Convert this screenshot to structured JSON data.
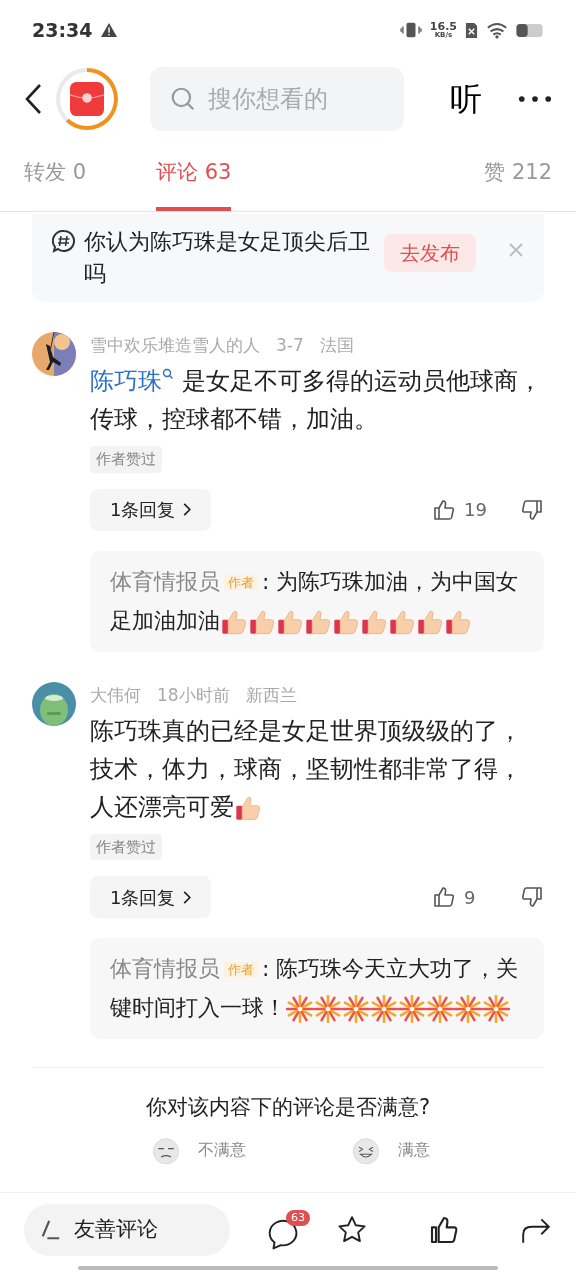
{
  "status_bar": {
    "time": "23:34",
    "net_speed": "16.5",
    "net_unit": "KB/s"
  },
  "header": {
    "search": {
      "placeholder": "搜你想看的"
    },
    "listen": "听"
  },
  "tabs": [
    {
      "label": "转发 0",
      "selected": false
    },
    {
      "label": "评论 63",
      "selected": true
    },
    {
      "label": "赞 212",
      "selected": false
    }
  ],
  "topic": {
    "text": "你认为陈巧珠是女足顶尖后卫吗",
    "button": "去发布"
  },
  "comments": [
    {
      "user": "雪中欢乐堆造雪人的人",
      "time": "3-7",
      "location": "法国",
      "mention": "陈巧珠",
      "text": "是女足不可多得的运动员他球商，传球，控球都不错，加油。",
      "badge": "作者赞过",
      "replies_button": "1条回复",
      "likes": "19",
      "reply": {
        "author": "体育情报员",
        "tag": "作者",
        "text": ": 为陈巧珠加油，为中国女足加油加油",
        "emojis": [
          {
            "kind": "thumbs"
          },
          {
            "kind": "thumbs"
          },
          {
            "kind": "thumbs"
          },
          {
            "kind": "thumbs"
          },
          {
            "kind": "thumbs"
          },
          {
            "kind": "thumbs"
          },
          {
            "kind": "thumbs"
          },
          {
            "kind": "thumbs"
          },
          {
            "kind": "thumbs"
          }
        ]
      }
    },
    {
      "user": "大伟何",
      "time": "18小时前",
      "location": "新西兰",
      "text": "陈巧珠真的已经是女足世界顶级级的了，技术，体力，球商，坚韧性都非常了得，人还漂亮可爱",
      "emojis": [
        {
          "kind": "thumbs"
        }
      ],
      "badge": "作者赞过",
      "replies_button": "1条回复",
      "likes": "9",
      "reply": {
        "author": "体育情报员",
        "tag": "作者",
        "text": ": 陈巧珠今天立大功了，关键时间打入一球！",
        "emojis": [
          {
            "kind": "firework"
          },
          {
            "kind": "firework"
          },
          {
            "kind": "firework"
          },
          {
            "kind": "firework"
          },
          {
            "kind": "firework"
          },
          {
            "kind": "firework"
          },
          {
            "kind": "firework"
          },
          {
            "kind": "firework"
          }
        ]
      }
    }
  ],
  "survey": {
    "question": "你对该内容下的评论是否满意?",
    "options": [
      {
        "kind": "unhappy",
        "label": "不满意"
      },
      {
        "kind": "happy",
        "label": "满意"
      }
    ]
  },
  "bottom_bar": {
    "input": {
      "placeholder": "友善评论"
    },
    "comment_count": "63"
  }
}
